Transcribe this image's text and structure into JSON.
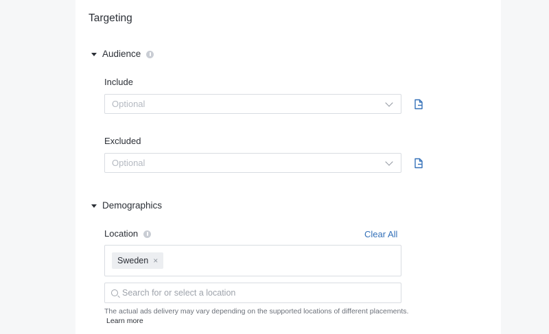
{
  "targeting": {
    "title": "Targeting"
  },
  "audience": {
    "heading": "Audience",
    "include": {
      "label": "Include",
      "placeholder": "Optional"
    },
    "excluded": {
      "label": "Excluded",
      "placeholder": "Optional"
    }
  },
  "demographics": {
    "heading": "Demographics",
    "location": {
      "label": "Location",
      "clear_all": "Clear All",
      "selected": [
        "Sweden"
      ],
      "tag_remove": "×",
      "search_placeholder": "Search for or select a location",
      "note": "The actual ads delivery may vary depending on the supported locations of different placements.",
      "learn_more": "Learn more"
    }
  },
  "colors": {
    "accent": "#3370b8",
    "border": "#d8dce1",
    "placeholder": "#b4b9c1"
  },
  "icons": {
    "section_toggle": "caret-down-icon",
    "info": "info-icon",
    "dropdown": "chevron-down-icon",
    "upload": "file-upload-icon",
    "search": "search-icon",
    "remove": "close-icon"
  }
}
